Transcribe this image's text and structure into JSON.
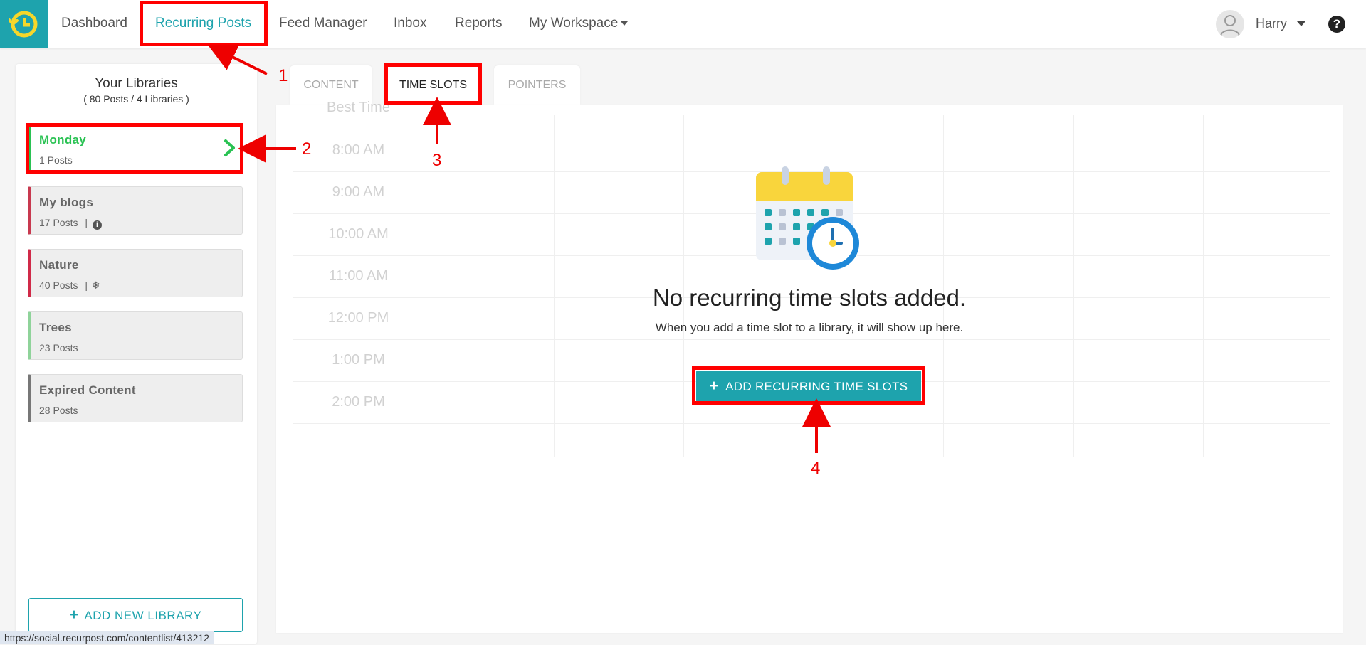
{
  "nav": {
    "items": [
      {
        "label": "Dashboard",
        "active": false
      },
      {
        "label": "Recurring Posts",
        "active": true
      },
      {
        "label": "Feed Manager",
        "active": false
      },
      {
        "label": "Inbox",
        "active": false
      },
      {
        "label": "Reports",
        "active": false
      },
      {
        "label": "My Workspace",
        "active": false
      }
    ],
    "user_name": "Harry",
    "help_icon": "?"
  },
  "sidebar": {
    "title": "Your Libraries",
    "subtitle": "( 80 Posts / 4 Libraries )",
    "libraries": [
      {
        "name": "Monday",
        "count": "1 Posts",
        "color": "#2ac253",
        "extra": "",
        "active": true
      },
      {
        "name": "My blogs",
        "count": "17 Posts",
        "color": "#c8394f",
        "extra": "|",
        "extra_icon": "info-icon",
        "active": false
      },
      {
        "name": "Nature",
        "count": "40 Posts",
        "color": "#d02a48",
        "extra": "|",
        "extra_icon": "snowflake-icon",
        "active": false
      },
      {
        "name": "Trees",
        "count": "23 Posts",
        "color": "#8fd39a",
        "extra": "",
        "active": false
      },
      {
        "name": "Expired Content",
        "count": "28 Posts",
        "color": "#777777",
        "extra": "",
        "active": false
      }
    ],
    "add_library_label": "ADD NEW LIBRARY",
    "add_library_icon": "+"
  },
  "tabs": [
    {
      "label": "CONTENT",
      "active": false
    },
    {
      "label": "TIME SLOTS",
      "active": true
    },
    {
      "label": "POINTERS",
      "active": false
    }
  ],
  "schedule": {
    "header_label": "Best Time",
    "times": [
      "8:00 AM",
      "9:00 AM",
      "10:00 AM",
      "11:00 AM",
      "12:00 PM",
      "1:00 PM",
      "2:00 PM"
    ]
  },
  "empty_state": {
    "title": "No recurring time slots added.",
    "subtitle": "When you add a time slot to a library, it will show up here.",
    "button_label": "ADD RECURRING TIME SLOTS",
    "button_icon": "+",
    "illustration": "calendar-clock-icon"
  },
  "annotations": {
    "labels": [
      "1",
      "2",
      "3",
      "4"
    ],
    "color": "#ff0000"
  },
  "status_bar": {
    "url": "https://social.recurpost.com/contentlist/413212"
  },
  "colors": {
    "accent": "#1ea3ad",
    "active_library": "#2ac253"
  }
}
